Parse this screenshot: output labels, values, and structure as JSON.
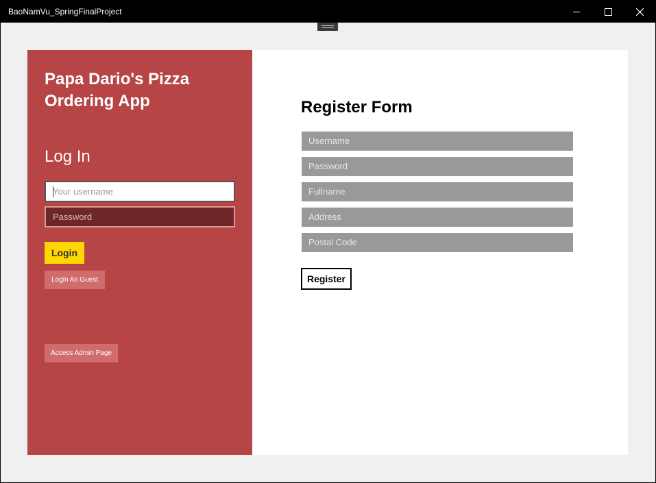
{
  "window": {
    "title": "BaoNamVu_SpringFinalProject"
  },
  "login_panel": {
    "app_title": "Papa Dario's Pizza Ordering App",
    "heading": "Log In",
    "username_placeholder": "Your username",
    "password_placeholder": "Password",
    "login_label": "Login",
    "guest_label": "Login As Guest",
    "admin_label": "Access Admin Page"
  },
  "register_panel": {
    "heading": "Register Form",
    "fields": [
      {
        "placeholder": "Username"
      },
      {
        "placeholder": "Password"
      },
      {
        "placeholder": "Fullname"
      },
      {
        "placeholder": "Address"
      },
      {
        "placeholder": "Postal Code"
      }
    ],
    "register_label": "Register"
  },
  "colors": {
    "titlebar": "#000000",
    "login_panel": "#b84546",
    "login_button": "#ffd700",
    "secondary_button": "#d16c6d",
    "register_field": "#999999"
  },
  "icons": {
    "minimize": "minimize-icon",
    "maximize": "maximize-icon",
    "close": "close-icon"
  }
}
